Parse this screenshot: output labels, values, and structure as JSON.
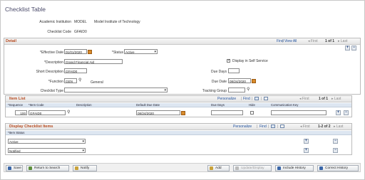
{
  "page": {
    "title": "Checklist Table",
    "institution_label": "Academic Institution",
    "institution_code": "MODEL",
    "institution_name": "Model Institute of Technology",
    "checklist_code_label": "Checklist Code",
    "checklist_code": "GFAID0"
  },
  "detail": {
    "title": "Detail",
    "find": "Find",
    "view_all": "View All",
    "first": "First",
    "pager": "1 of 1",
    "last": "Last",
    "effective_date_label": "*Effective Date",
    "effective_date": "01/01/2020",
    "status_label": "*Status",
    "status": "Active",
    "description_label": "*Description",
    "description": "Grand Financial Aid",
    "display_self_service": "Display in Self Service",
    "short_description_label": "Short Description",
    "short_description": "GFAID0",
    "due_days_label": "Due Days",
    "due_days": "",
    "function_label": "*Function",
    "function": "GEN",
    "function_desc": "General",
    "due_date_label": "Due Date",
    "due_date": "08/24/2020",
    "checklist_type_label": "Checklist Type",
    "checklist_type": "",
    "tracking_group_label": "Tracking Group",
    "tracking_group": ""
  },
  "item_list": {
    "title": "Item List",
    "personalize": "Personalize",
    "find": "Find",
    "first": "First",
    "pager": "1 of 1",
    "last": "Last",
    "columns": [
      "*Sequence",
      "*Item Code",
      "Description",
      "Default Due Date",
      "Due Days",
      "Hide",
      "Communication Key"
    ],
    "rows": [
      {
        "sequence": "100",
        "item_code": "GFAID0",
        "description": "",
        "default_due_date": "08/24/2020",
        "due_days": "",
        "hide": false,
        "communication_key": ""
      }
    ]
  },
  "display_items": {
    "title": "Display Checklist Items",
    "personalize": "Personalize",
    "find": "Find",
    "first": "First",
    "pager": "1-2 of 2",
    "last": "Last",
    "column": "*Item Status",
    "rows": [
      {
        "status": "Active"
      },
      {
        "status": "Notified"
      }
    ]
  },
  "toolbar": {
    "save": "Save",
    "return_to_search": "Return to Search",
    "notify": "Notify",
    "add": "Add",
    "update_display": "Update/Display",
    "include_history": "Include History",
    "correct_history": "Correct History"
  },
  "colors": {
    "section_title": "#b5491e",
    "link": "#1e4f9c",
    "grid_header": "#dde6f1"
  }
}
